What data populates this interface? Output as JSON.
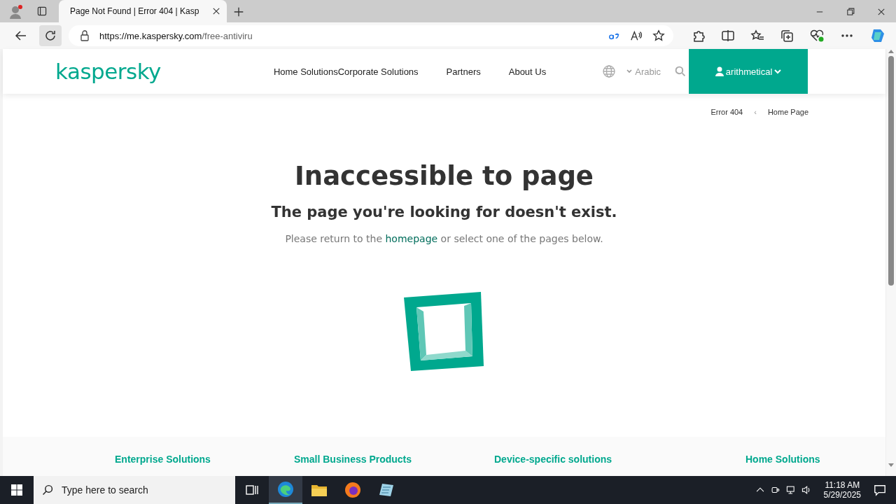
{
  "browser": {
    "tab_title": "Page Not Found | Error 404 | Kasp",
    "url_host": "https://me.kaspersky.com",
    "url_path": "/free-antiviru"
  },
  "site_header": {
    "logo": "kaspersky",
    "nav": [
      {
        "label": "Home Solutions"
      },
      {
        "label": "Corporate Solutions"
      },
      {
        "label": "Partners"
      },
      {
        "label": "About Us"
      }
    ],
    "language": "Arabic",
    "account": "arithmetical"
  },
  "breadcrumb": {
    "items": [
      {
        "label": "Error 404"
      },
      {
        "label": "Home Page"
      }
    ],
    "separator": "‹"
  },
  "error": {
    "title": "Inaccessible to page",
    "subtitle": "The page you're looking for doesn't exist.",
    "message_before": "Please return to the ",
    "link": "homepage",
    "message_after": " or select one of the pages below."
  },
  "footer_links": [
    {
      "label": "Enterprise Solutions"
    },
    {
      "label": "Small Business Products"
    },
    {
      "label": "Device-specific solutions"
    },
    {
      "label": "Home Solutions"
    }
  ],
  "taskbar": {
    "search_placeholder": "Type here to search",
    "time": "11:18 AM",
    "date": "5/29/2025"
  }
}
